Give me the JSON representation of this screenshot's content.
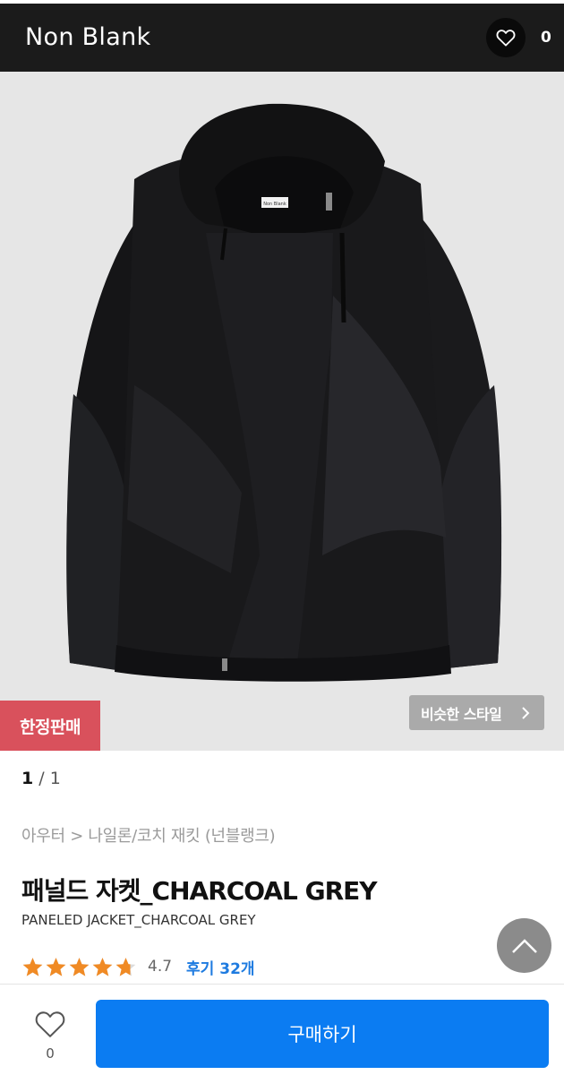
{
  "header": {
    "brand": "Non Blank",
    "like_count": "0"
  },
  "gallery": {
    "badge": "한정판매",
    "similar_button": "비슷한 스타일",
    "current_page": "1",
    "separator": "/",
    "total_pages": "1",
    "image_label": "Non Blank"
  },
  "product": {
    "breadcrumb": "아우터 > 나일론/코치 재킷 (넌블랭크)",
    "title_ko": "패널드 자켓_CHARCOAL GREY",
    "title_en": "PANELED JACKET_CHARCOAL GREY",
    "rating": 4.7,
    "rating_text": "4.7",
    "reviews": "후기 32개"
  },
  "bottom": {
    "wish_count": "0",
    "buy_label": "구매하기"
  },
  "colors": {
    "header_bg": "#1b1b1b",
    "badge_bg": "#d9515c",
    "buy_bg": "#0b7cf2",
    "star": "#f08a24",
    "review_link": "#1e7be0"
  },
  "icons": {
    "header_like": "heart-outline-icon",
    "similar_chevron": "chevron-right-icon",
    "scroll_top": "chevron-up-icon",
    "wish": "heart-outline-icon",
    "rating": "star-icon"
  }
}
